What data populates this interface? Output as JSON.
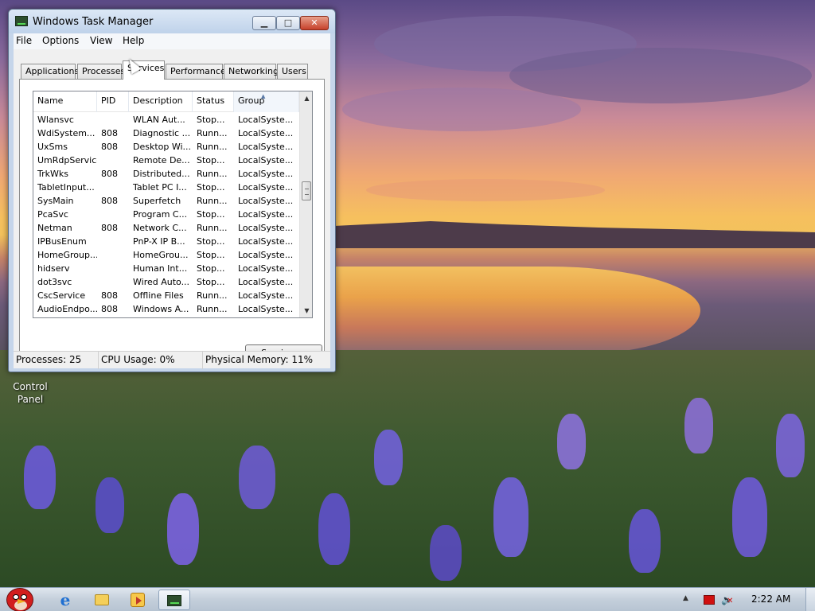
{
  "desktop": {
    "icons": [
      {
        "label": "Control\nPanel"
      }
    ]
  },
  "window": {
    "title": "Windows Task Manager",
    "menu": [
      "File",
      "Options",
      "View",
      "Help"
    ],
    "tabs": [
      "Applications",
      "Processes",
      "Services",
      "Performance",
      "Networking",
      "Users"
    ],
    "active_tab": "Services",
    "columns": [
      "Name",
      "PID",
      "Description",
      "Status",
      "Group"
    ],
    "sorted_column": "Group",
    "services": [
      {
        "name": "Wlansvc",
        "pid": "",
        "description": "WLAN Aut...",
        "status": "Stop...",
        "group": "LocalSyste..."
      },
      {
        "name": "WdiSystem...",
        "pid": "808",
        "description": "Diagnostic ...",
        "status": "Runn...",
        "group": "LocalSyste..."
      },
      {
        "name": "UxSms",
        "pid": "808",
        "description": "Desktop Wi...",
        "status": "Runn...",
        "group": "LocalSyste..."
      },
      {
        "name": "UmRdpService",
        "pid": "",
        "description": "Remote De...",
        "status": "Stop...",
        "group": "LocalSyste..."
      },
      {
        "name": "TrkWks",
        "pid": "808",
        "description": "Distributed...",
        "status": "Runn...",
        "group": "LocalSyste..."
      },
      {
        "name": "TabletInput...",
        "pid": "",
        "description": "Tablet PC I...",
        "status": "Stop...",
        "group": "LocalSyste..."
      },
      {
        "name": "SysMain",
        "pid": "808",
        "description": "Superfetch",
        "status": "Runn...",
        "group": "LocalSyste..."
      },
      {
        "name": "PcaSvc",
        "pid": "",
        "description": "Program C...",
        "status": "Stop...",
        "group": "LocalSyste..."
      },
      {
        "name": "Netman",
        "pid": "808",
        "description": "Network C...",
        "status": "Runn...",
        "group": "LocalSyste..."
      },
      {
        "name": "IPBusEnum",
        "pid": "",
        "description": "PnP-X IP B...",
        "status": "Stop...",
        "group": "LocalSyste..."
      },
      {
        "name": "HomeGroup...",
        "pid": "",
        "description": "HomeGrou...",
        "status": "Stop...",
        "group": "LocalSyste..."
      },
      {
        "name": "hidserv",
        "pid": "",
        "description": "Human Int...",
        "status": "Stop...",
        "group": "LocalSyste..."
      },
      {
        "name": "dot3svc",
        "pid": "",
        "description": "Wired Auto...",
        "status": "Stop...",
        "group": "LocalSyste..."
      },
      {
        "name": "CscService",
        "pid": "808",
        "description": "Offline Files",
        "status": "Runn...",
        "group": "LocalSyste..."
      },
      {
        "name": "AudioEndpo...",
        "pid": "808",
        "description": "Windows A...",
        "status": "Runn...",
        "group": "LocalSyste..."
      }
    ],
    "services_button": "Services...",
    "status": {
      "processes": "Processes: 25",
      "cpu": "CPU Usage: 0%",
      "memory": "Physical Memory: 11%"
    }
  },
  "taskbar": {
    "clock": "2:22 AM",
    "pinned_icons": [
      "angry-bird-start-icon",
      "internet-explorer-icon",
      "folder-icon",
      "media-player-icon",
      "task-manager-icon"
    ]
  }
}
